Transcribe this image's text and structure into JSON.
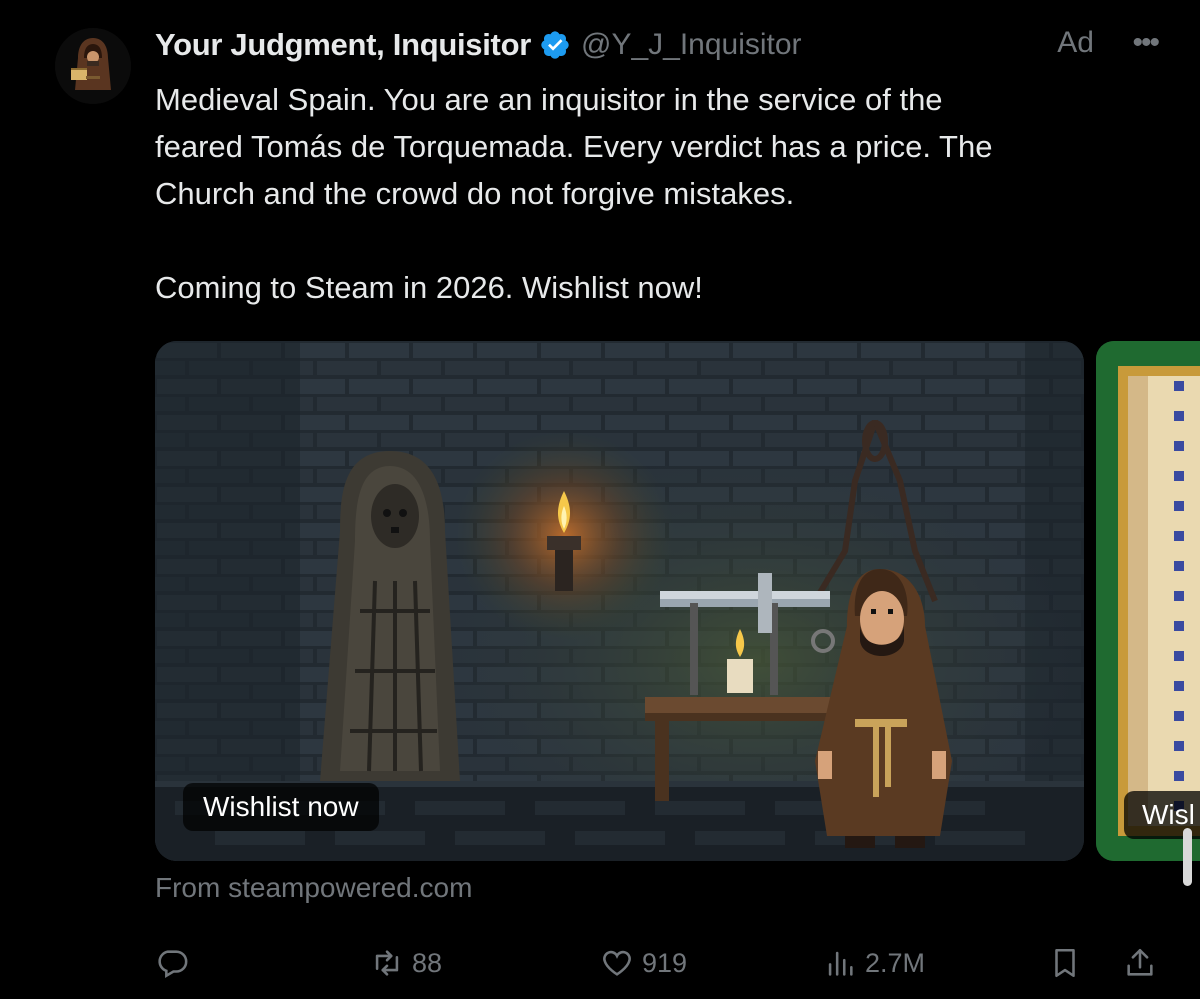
{
  "account": {
    "display_name": "Your Judgment, Inquisitor",
    "handle": "@Y_J_Inquisitor",
    "ad_label": "Ad",
    "more_label": "•••"
  },
  "tweet": {
    "text": "Medieval Spain. You are an inquisitor in the service of the\nfeared Tomás de Torquemada. Every verdict has a price. The\nChurch and the crowd do not forgive mistakes.\n\nComing to Steam in 2026. Wishlist now!"
  },
  "media": {
    "card1_button": "Wishlist now",
    "card2_button": "Wishlist now",
    "card2_button_visible": "Wisl"
  },
  "source": "From steampowered.com",
  "stats": {
    "replies": "",
    "retweets": "88",
    "likes": "919",
    "views": "2.7M"
  },
  "colors": {
    "background": "#000000",
    "text_primary": "#e7e9ea",
    "text_secondary": "#71767b",
    "verified_blue": "#1d9bf0"
  }
}
